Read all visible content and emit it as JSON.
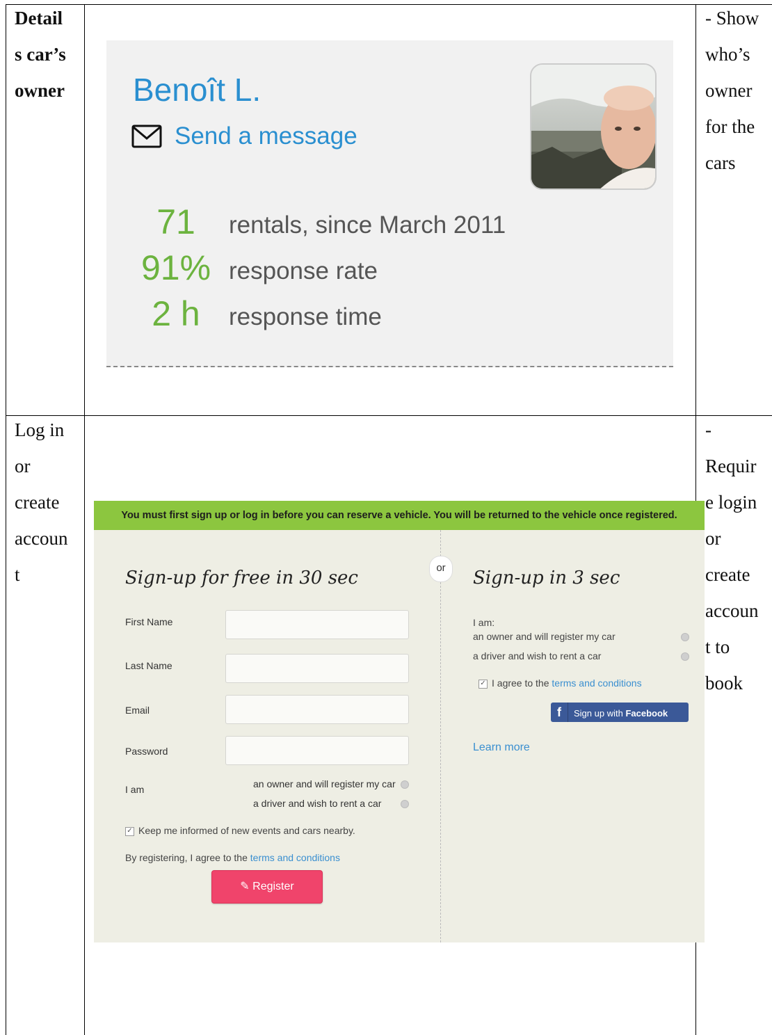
{
  "row1": {
    "label_lines": [
      "Detail",
      "s car’s",
      "owner"
    ],
    "note_lines": [
      "- Show",
      "who’s",
      "owner",
      "for the",
      "cars"
    ]
  },
  "owner_card": {
    "name": "Benoît L.",
    "message_label": "Send a message",
    "stats": [
      {
        "value": "71",
        "label": "rentals, since March 2011"
      },
      {
        "value": "91%",
        "label": "response rate"
      },
      {
        "value": "2 h",
        "label": "response time"
      }
    ]
  },
  "row2": {
    "label_lines": [
      "Log in",
      "or",
      "create",
      "accoun",
      "t"
    ],
    "note_lines": [
      "-",
      "Requir",
      "e login",
      "or",
      "create",
      "accoun",
      "t to",
      "book"
    ]
  },
  "signup": {
    "banner": "You must first sign up or log in before you can reserve a vehicle. You will be returned to the vehicle once registered.",
    "or_label": "or",
    "left": {
      "title": "Sign-up for free in 30 sec",
      "fields": [
        "First Name",
        "Last Name",
        "Email",
        "Password"
      ],
      "i_am": "I am",
      "options": [
        "an owner and will register my car",
        "a driver and wish to rent a car"
      ],
      "keep_informed": "Keep me informed of new events and cars nearby.",
      "agree_prefix": "By registering, I agree to the ",
      "agree_link": "terms and conditions",
      "register": "Register"
    },
    "right": {
      "title": "Sign-up in 3 sec",
      "i_am": "I am:",
      "options": [
        "an owner and will register my car",
        "a driver and wish to rent a car"
      ],
      "agree_prefix": "I agree to the ",
      "agree_link": "terms and conditions",
      "facebook_prefix": "Sign up with ",
      "facebook_brand": "Facebook",
      "learn_more": "Learn more"
    }
  },
  "colors": {
    "accent_blue": "#2a8fd0",
    "stat_green": "#6cb33f",
    "banner_green": "#8cc63f",
    "register_pink": "#f0446b",
    "facebook_blue": "#3b5998"
  }
}
